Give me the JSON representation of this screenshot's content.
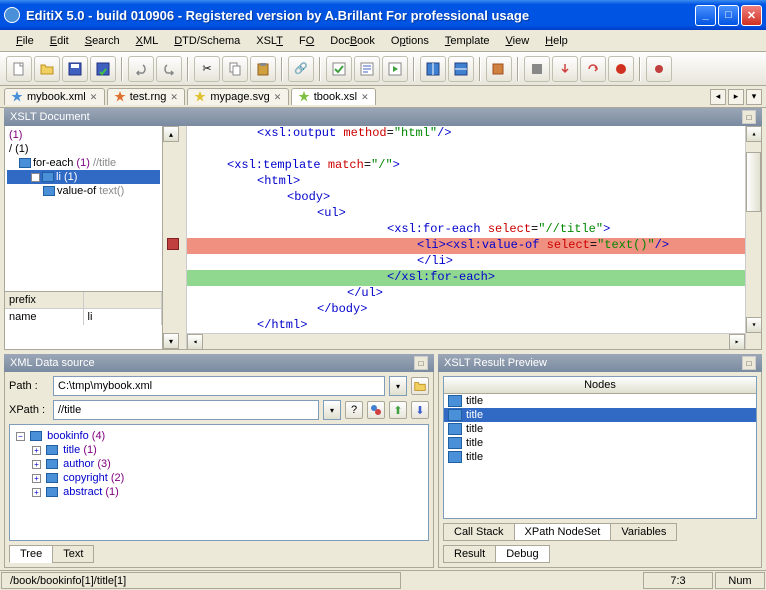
{
  "window": {
    "title": "EditiX 5.0 - build 010906 - Registered version by A.Brillant For professional usage"
  },
  "menu": {
    "items": [
      "File",
      "Edit",
      "Search",
      "XML",
      "DTD/Schema",
      "XSLT",
      "FO",
      "DocBook",
      "Options",
      "Template",
      "View",
      "Help"
    ]
  },
  "tabs": {
    "items": [
      {
        "name": "mybook.xml",
        "star_color": "#4a90d9",
        "active": false
      },
      {
        "name": "test.rng",
        "star_color": "#e07030",
        "active": false
      },
      {
        "name": "mypage.svg",
        "star_color": "#e0c030",
        "active": false
      },
      {
        "name": "tbook.xsl",
        "star_color": "#80c040",
        "active": true
      }
    ]
  },
  "xslt_panel": {
    "title": "XSLT Document",
    "tree": {
      "n0": "(1)",
      "n1": "/ (1)",
      "n2_label": "for-each",
      "n2_count": "(1)",
      "n2_path": "//title",
      "n3_label": "li",
      "n3_count": "(1)",
      "n4_label": "value-of",
      "n4_path": "text()"
    },
    "prop": {
      "h1": "prefix",
      "h2": "",
      "r1": "name",
      "r2": "li"
    }
  },
  "code": {
    "l0_tag": "<xsl:output",
    "l0_attr": " method",
    "l0_eq": "=",
    "l0_val": "\"html\"",
    "l0_end": "/>",
    "l1_tag": "<xsl:template",
    "l1_attr": " match",
    "l1_val": "\"/\"",
    "l1_end": ">",
    "l2": "<html>",
    "l3": "<body>",
    "l4": "<ul>",
    "l5_tag": "<xsl:for-each",
    "l5_attr": " select",
    "l5_val": "\"//title\"",
    "l5_end": ">",
    "l6_open": "<li>",
    "l6_tag": "<xsl:value-of",
    "l6_attr": " select",
    "l6_val": "\"text()\"",
    "l6_end": "/>",
    "l7": "</li>",
    "l8": "</xsl:for-each>",
    "l9": "</ul>",
    "l10": "</body>",
    "l11": "</html>"
  },
  "datasource": {
    "title": "XML Data source",
    "path_label": "Path :",
    "path_value": "C:\\tmp\\mybook.xml",
    "xpath_label": "XPath :",
    "xpath_value": "//title",
    "tree": {
      "root": "bookinfo",
      "root_count": "(4)",
      "items": [
        {
          "label": "title",
          "count": "(1)"
        },
        {
          "label": "author",
          "count": "(3)"
        },
        {
          "label": "copyright",
          "count": "(2)"
        },
        {
          "label": "abstract",
          "count": "(1)"
        }
      ]
    },
    "tabs": [
      "Tree",
      "Text"
    ]
  },
  "result": {
    "title": "XSLT Result Preview",
    "nodes_header": "Nodes",
    "rows": [
      "title",
      "title",
      "title",
      "title",
      "title"
    ],
    "selected_index": 1,
    "upper_tabs": [
      "Call Stack",
      "XPath NodeSet",
      "Variables"
    ],
    "lower_tabs": [
      "Result",
      "Debug"
    ]
  },
  "status": {
    "path": "/book/bookinfo[1]/title[1]",
    "pos": "7:3",
    "mode": "Num"
  }
}
